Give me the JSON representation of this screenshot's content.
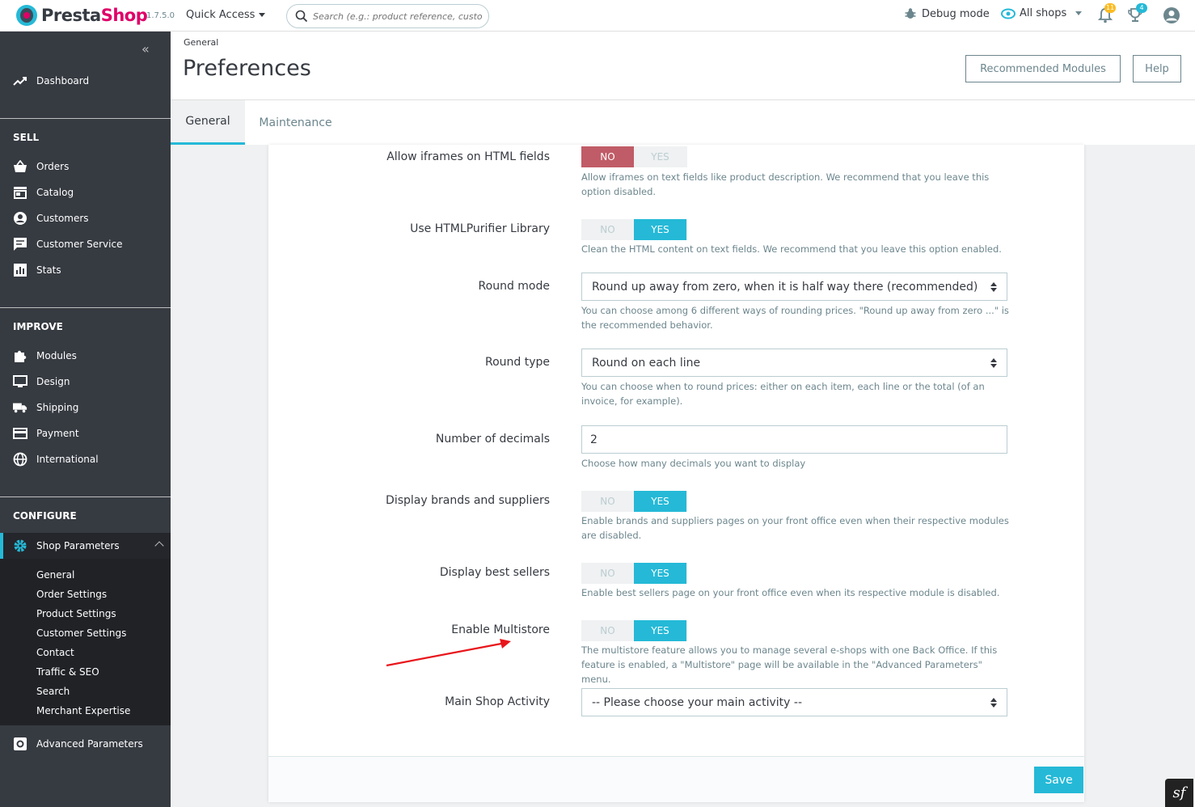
{
  "header": {
    "logo_text_1": "Presta",
    "logo_text_2": "Shop",
    "version": "1.7.5.0",
    "quick_access": "Quick Access",
    "search_placeholder": "Search (e.g.: product reference, customer",
    "debug_mode": "Debug mode",
    "all_shops": "All shops",
    "notifications_count": "11",
    "trophy_count": "4",
    "accent_color": "#df0067",
    "brand_color": "#25b9d7"
  },
  "sidebar": {
    "dashboard": "Dashboard",
    "sell_title": "SELL",
    "sell_items": [
      "Orders",
      "Catalog",
      "Customers",
      "Customer Service",
      "Stats"
    ],
    "improve_title": "IMPROVE",
    "improve_items": [
      "Modules",
      "Design",
      "Shipping",
      "Payment",
      "International"
    ],
    "configure_title": "CONFIGURE",
    "shop_parameters": "Shop Parameters",
    "sub_items": [
      "General",
      "Order Settings",
      "Product Settings",
      "Customer Settings",
      "Contact",
      "Traffic & SEO",
      "Search",
      "Merchant Expertise"
    ],
    "advanced_parameters": "Advanced Parameters"
  },
  "page": {
    "breadcrumb": "General",
    "title": "Preferences",
    "recommended_modules": "Recommended Modules",
    "help": "Help",
    "tabs": [
      "General",
      "Maintenance"
    ]
  },
  "form": {
    "iframes": {
      "label": "Allow iframes on HTML fields",
      "no": "NO",
      "yes": "YES",
      "value": "NO",
      "help": "Allow iframes on text fields like product description. We recommend that you leave this option disabled."
    },
    "htmlpurifier": {
      "label": "Use HTMLPurifier Library",
      "no": "NO",
      "yes": "YES",
      "value": "YES",
      "help": "Clean the HTML content on text fields. We recommend that you leave this option enabled."
    },
    "round_mode": {
      "label": "Round mode",
      "value": "Round up away from zero, when it is half way there (recommended)",
      "help": "You can choose among 6 different ways of rounding prices. \"Round up away from zero ...\" is the recommended behavior."
    },
    "round_type": {
      "label": "Round type",
      "value": "Round on each line",
      "help": "You can choose when to round prices: either on each item, each line or the total (of an invoice, for example)."
    },
    "decimals": {
      "label": "Number of decimals",
      "value": "2",
      "help": "Choose how many decimals you want to display"
    },
    "brands": {
      "label": "Display brands and suppliers",
      "no": "NO",
      "yes": "YES",
      "value": "YES",
      "help": "Enable brands and suppliers pages on your front office even when their respective modules are disabled."
    },
    "best_sellers": {
      "label": "Display best sellers",
      "no": "NO",
      "yes": "YES",
      "value": "YES",
      "help": "Enable best sellers page on your front office even when its respective module is disabled."
    },
    "multistore": {
      "label": "Enable Multistore",
      "no": "NO",
      "yes": "YES",
      "value": "YES",
      "help": "The multistore feature allows you to manage several e-shops with one Back Office. If this feature is enabled, a \"Multistore\" page will be available in the \"Advanced Parameters\" menu."
    },
    "main_activity": {
      "label": "Main Shop Activity",
      "value": "-- Please choose your main activity --"
    },
    "save": "Save"
  }
}
